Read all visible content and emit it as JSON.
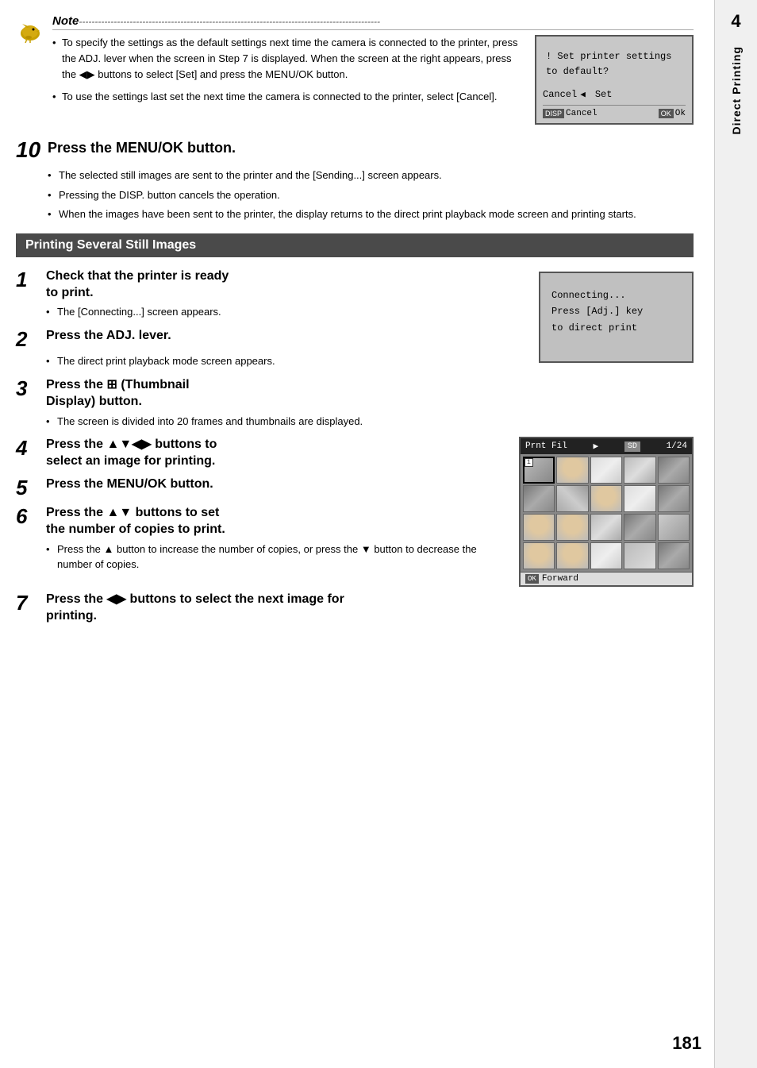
{
  "note": {
    "title": "Note",
    "dashes": "------------------------------------------------------------------------------------------------",
    "bullets": [
      "To specify the settings as the default settings next time the camera is connected to the printer, press the ADJ. lever when the screen in Step 7 is displayed. When the screen at the right appears, press the ◀▶ buttons to select [Set] and press the MENU/OK button.",
      "To use the settings last set the next time the camera is connected to the printer, select [Cancel]."
    ],
    "lcd": {
      "line1": "! Set printer settings",
      "line2": "  to default?",
      "cancel_label": "Cancel",
      "cancel_arrow": "◀",
      "set_label": "Set",
      "btn_disp": "DISP",
      "btn_disp_action": "Cancel",
      "btn_ok": "OK",
      "btn_ok_action": "Ok"
    }
  },
  "step10": {
    "number": "10",
    "title": "Press the MENU/OK button.",
    "bullets": [
      "The selected still images are sent to the printer and the [Sending...] screen appears.",
      "Pressing the DISP. button cancels the operation.",
      "When the images have been sent to the printer, the display returns to the direct print playback mode screen and printing starts."
    ]
  },
  "section_header": "Printing Several Still Images",
  "steps": [
    {
      "number": "1",
      "title": "Check that the printer is ready to print.",
      "bullets": [
        "The [Connecting...] screen appears."
      ]
    },
    {
      "number": "2",
      "title": "Press the ADJ. lever.",
      "bullets": [
        "The direct print playback mode screen appears."
      ]
    },
    {
      "number": "3",
      "title": "Press the ⊞ (Thumbnail Display) button.",
      "bullets": [
        "The screen is divided into 20 frames and thumbnails are displayed."
      ]
    },
    {
      "number": "4",
      "title": "Press the ▲▼◀▶ buttons to select an image for printing.",
      "bullets": []
    },
    {
      "number": "5",
      "title": "Press the MENU/OK button.",
      "bullets": []
    },
    {
      "number": "6",
      "title": "Press the ▲▼ buttons to set the number of copies to print.",
      "bullets": [
        "Press the ▲ button to increase the number of copies, or press the ▼ button to decrease the number of copies."
      ]
    },
    {
      "number": "7",
      "title": "Press the ◀▶ buttons to select the next image for printing.",
      "bullets": []
    }
  ],
  "lcd_connecting": {
    "line1": "Connecting...",
    "line2": "Press [Adj.] key",
    "line3": "to direct print"
  },
  "lcd_thumbnail": {
    "header_left": "Prnt Fil",
    "header_play": "▶",
    "header_sd": "SD",
    "header_count": "1/24",
    "footer_ok": "OK",
    "footer_label": "Forward",
    "grid_rows": 4,
    "grid_cols": 5,
    "total_cells": 20
  },
  "page_number": "181",
  "sidebar": {
    "tab_number": "4",
    "tab_text": "Direct Printing"
  }
}
